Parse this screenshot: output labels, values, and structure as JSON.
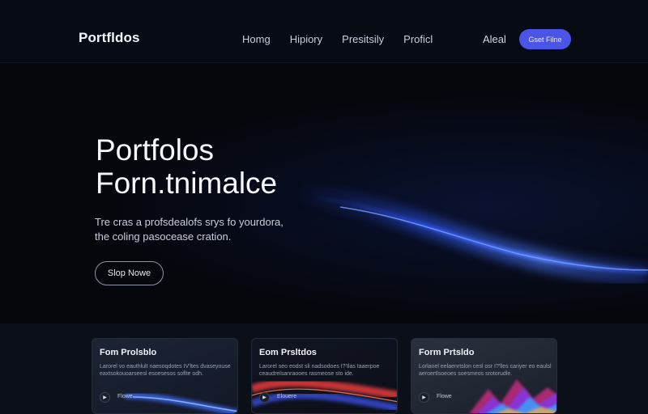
{
  "nav": {
    "brand": "Portfldos",
    "links": [
      "Homg",
      "Hipiory",
      "Presitsily",
      "Proficl"
    ],
    "login": "Aleal",
    "cta": "Gset Filne"
  },
  "hero": {
    "title_line1": "Portfolos",
    "title_line2": "Forn.tnimalce",
    "subtitle_line1": "Tre cras a profsdealofs srys fo yourdora,",
    "subtitle_line2": "the coling pasocease cration.",
    "button": "Slop Nowe"
  },
  "cards": [
    {
      "title": "Fom Prolsblo",
      "text": "Larorel vo eauthlult naesoqdotes IV'ltes dvaseyouse eaxtsokouoarseesl esoesesos soflte odh.",
      "link": "Flowe",
      "art": "blue-wave"
    },
    {
      "title": "Eom Prsltdos",
      "text": "Larorel seo eodst sli nadsodoes I?'Ilas taaerpoe ceaudrelsanraooes rasmeose sto ide.",
      "link": "Elouere",
      "art": "red-blue-wave"
    },
    {
      "title": "Form Prtsldo",
      "text": "Lorlanel eelaenrtslon cesl osr I?'lles cariyer eo eaulsl aeroertlsoeoes soesmeos srotorudle.",
      "link": "Flowe",
      "art": "rainbow-wave"
    }
  ],
  "colors": {
    "accent": "#4a55e8",
    "background": "#05070d",
    "wave": "#3a6cff"
  },
  "icons": {
    "card_play": "play-icon"
  }
}
